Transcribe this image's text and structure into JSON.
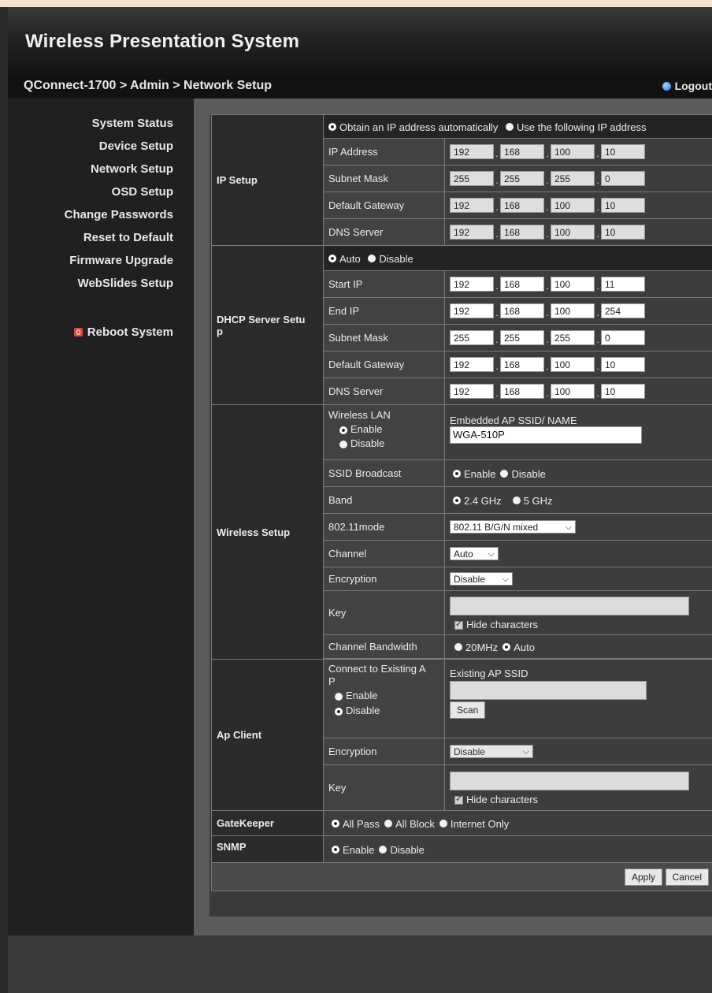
{
  "header": {
    "title": "Wireless Presentation System"
  },
  "subbar": {
    "breadcrumb": "QConnect-1700 > Admin > Network Setup",
    "logout": "Logout"
  },
  "sidebar": {
    "items": [
      "System Status",
      "Device Setup",
      "Network Setup",
      "OSD Setup",
      "Change Passwords",
      "Reset to Default",
      "Firmware Upgrade",
      "WebSlides Setup"
    ],
    "reboot": "Reboot System"
  },
  "ip_setup": {
    "section": "IP Setup",
    "mode_auto": "Obtain an IP address automatically",
    "mode_manual": "Use the following IP address",
    "rows": [
      {
        "label": "IP Address",
        "octets": [
          "192",
          "168",
          "100",
          "10"
        ]
      },
      {
        "label": "Subnet Mask",
        "octets": [
          "255",
          "255",
          "255",
          "0"
        ]
      },
      {
        "label": "Default Gateway",
        "octets": [
          "192",
          "168",
          "100",
          "10"
        ]
      },
      {
        "label": "DNS Server",
        "octets": [
          "192",
          "168",
          "100",
          "10"
        ]
      }
    ]
  },
  "dhcp": {
    "section_line1": "DHCP Server Setu",
    "section_line2": "p",
    "auto": "Auto",
    "disable": "Disable",
    "rows": [
      {
        "label": "Start IP",
        "octets": [
          "192",
          "168",
          "100",
          "11"
        ]
      },
      {
        "label": "End IP",
        "octets": [
          "192",
          "168",
          "100",
          "254"
        ]
      },
      {
        "label": "Subnet Mask",
        "octets": [
          "255",
          "255",
          "255",
          "0"
        ]
      },
      {
        "label": "Default Gateway",
        "octets": [
          "192",
          "168",
          "100",
          "10"
        ]
      },
      {
        "label": "DNS Server",
        "octets": [
          "192",
          "168",
          "100",
          "10"
        ]
      }
    ]
  },
  "wireless": {
    "section": "Wireless Setup",
    "lan_label": "Wireless LAN",
    "enable": "Enable",
    "disable": "Disable",
    "ssid_label": "Embedded AP SSID/ NAME",
    "ssid_value": "WGA-510P",
    "ssid_broadcast": "SSID Broadcast",
    "band_label": "Band",
    "band_24": "2.4 GHz",
    "band_5": "5 GHz",
    "mode_label": "802.11mode",
    "mode_value": "802.11 B/G/N mixed",
    "channel_label": "Channel",
    "channel_value": "Auto",
    "encryption_label": "Encryption",
    "encryption_value": "Disable",
    "key_label": "Key",
    "hide_chars": "Hide characters",
    "bw_label": "Channel Bandwidth",
    "bw_20": "20MHz",
    "bw_auto": "Auto"
  },
  "ap_client": {
    "section": "Ap Client",
    "connect_line1": "Connect to Existing A",
    "connect_line2": "P",
    "enable": "Enable",
    "disable": "Disable",
    "existing_ssid": "Existing AP SSID",
    "scan": "Scan",
    "encryption_label": "Encryption",
    "encryption_value": "Disable",
    "key_label": "Key",
    "hide_chars": "Hide characters"
  },
  "gatekeeper": {
    "section": "GateKeeper",
    "all_pass": "All Pass",
    "all_block": "All Block",
    "internet_only": "Internet Only"
  },
  "snmp": {
    "section": "SNMP",
    "enable": "Enable",
    "disable": "Disable"
  },
  "actions": {
    "apply": "Apply",
    "cancel": "Cancel"
  },
  "icons": {
    "logout": "globe-icon",
    "reboot": "power-icon"
  }
}
